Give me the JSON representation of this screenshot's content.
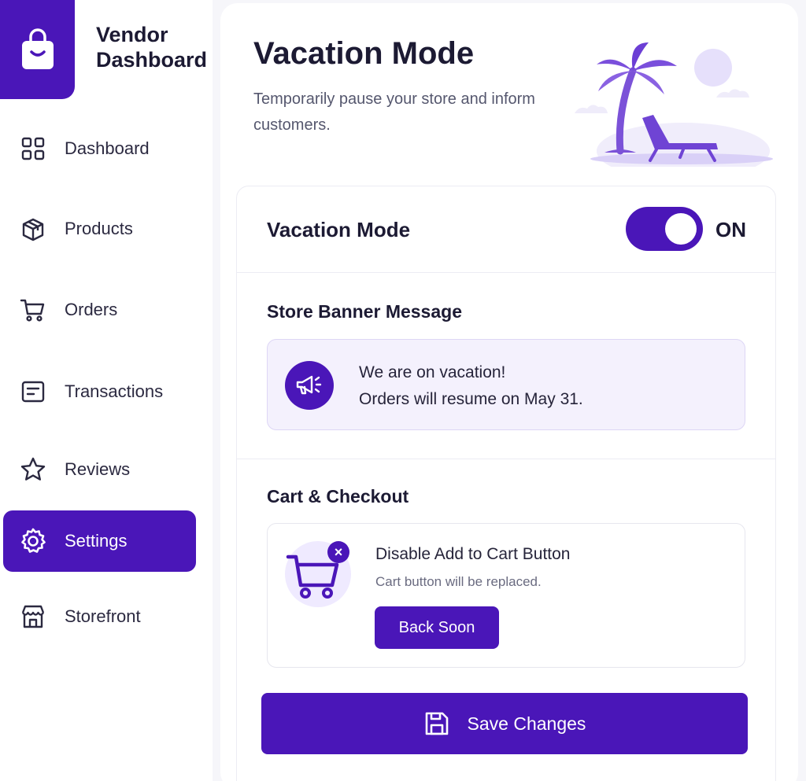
{
  "brand": {
    "title_line1": "Vendor",
    "title_line2": "Dashboard"
  },
  "sidebar": {
    "items": [
      {
        "label": "Dashboard",
        "icon": "grid-icon"
      },
      {
        "label": "Products",
        "icon": "box-icon"
      },
      {
        "label": "Orders",
        "icon": "cart-icon"
      },
      {
        "label": "Transactions",
        "icon": "receipt-icon"
      },
      {
        "label": "Reviews",
        "icon": "star-icon"
      },
      {
        "label": "Settings",
        "icon": "gear-icon",
        "active": true
      },
      {
        "label": "Storefront",
        "icon": "store-icon"
      }
    ]
  },
  "page": {
    "title": "Vacation Mode",
    "subtitle": "Temporarily pause your store and inform customers."
  },
  "vacation": {
    "label": "Vacation Mode",
    "state": "ON",
    "enabled": true
  },
  "banner": {
    "section_title": "Store Banner Message",
    "line1": "We are on vacation!",
    "line2": "Orders will resume on May 31."
  },
  "cart": {
    "section_title": "Cart & Checkout",
    "option_title": "Disable Add to Cart Button",
    "option_desc": "Cart button will be replaced.",
    "button_label": "Back Soon"
  },
  "actions": {
    "save_label": "Save Changes"
  },
  "colors": {
    "accent": "#4a16b8",
    "accent_light": "#efeaff",
    "text": "#1c1a33"
  }
}
